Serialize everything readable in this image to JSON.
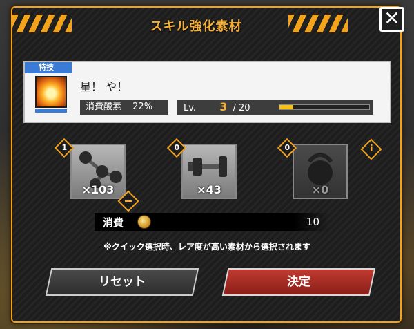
{
  "dialog": {
    "title": "スキル強化素材",
    "close_label": "✕"
  },
  "skill": {
    "tag": "特技",
    "name": "星！ や！",
    "oxygen_label": "消費酸素",
    "oxygen_value": "22%",
    "lv_label": "Lv.",
    "lv_current": "3",
    "lv_max": "/ 20",
    "lv_progress": 0.15
  },
  "materials": [
    {
      "selected": "1",
      "count": "×103",
      "icon": "dumbbell-small-icon",
      "enabled": true
    },
    {
      "selected": "0",
      "count": "×43",
      "icon": "dumbbell-icon",
      "enabled": true
    },
    {
      "selected": "0",
      "count": "×0",
      "icon": "kettlebell-icon",
      "enabled": false
    }
  ],
  "info_icon": "i",
  "cost": {
    "label": "消費",
    "value": "10"
  },
  "note": "※クイック選択時、レア度が高い素材から選択されます",
  "buttons": {
    "reset": "リセット",
    "confirm": "決定"
  }
}
